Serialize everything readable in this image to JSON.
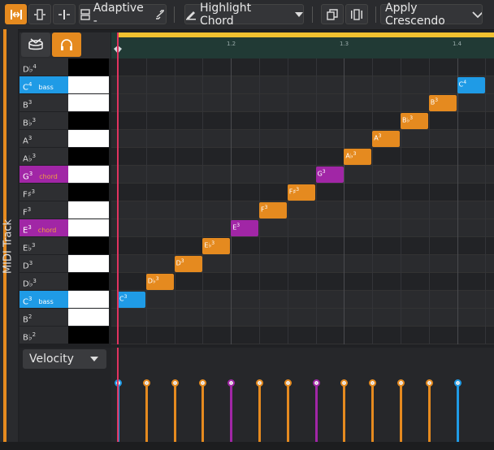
{
  "toolbar": {
    "snap_label": "Adaptive -",
    "highlight_label": "Highlight Chord",
    "crescendo_label": "Apply Crescendo"
  },
  "track": {
    "name": "MIDI Track",
    "color": "#e58a1f"
  },
  "timeline": {
    "markers": [
      "1.2",
      "1.3",
      "1.4"
    ]
  },
  "keys": [
    {
      "name": "D♭",
      "octave": "4",
      "tag": "",
      "black": true,
      "highlight": ""
    },
    {
      "name": "C",
      "octave": "4",
      "tag": "bass",
      "black": false,
      "highlight": "#1f9be6"
    },
    {
      "name": "B",
      "octave": "3",
      "tag": "",
      "black": false,
      "highlight": ""
    },
    {
      "name": "B♭",
      "octave": "3",
      "tag": "",
      "black": true,
      "highlight": ""
    },
    {
      "name": "A",
      "octave": "3",
      "tag": "",
      "black": false,
      "highlight": ""
    },
    {
      "name": "A♭",
      "octave": "3",
      "tag": "",
      "black": true,
      "highlight": ""
    },
    {
      "name": "G",
      "octave": "3",
      "tag": "chord",
      "black": false,
      "highlight": "#a126a6"
    },
    {
      "name": "F♯",
      "octave": "3",
      "tag": "",
      "black": true,
      "highlight": ""
    },
    {
      "name": "F",
      "octave": "3",
      "tag": "",
      "black": false,
      "highlight": ""
    },
    {
      "name": "E",
      "octave": "3",
      "tag": "chord",
      "black": false,
      "highlight": "#a126a6"
    },
    {
      "name": "E♭",
      "octave": "3",
      "tag": "",
      "black": true,
      "highlight": ""
    },
    {
      "name": "D",
      "octave": "3",
      "tag": "",
      "black": false,
      "highlight": ""
    },
    {
      "name": "D♭",
      "octave": "3",
      "tag": "",
      "black": true,
      "highlight": ""
    },
    {
      "name": "C",
      "octave": "3",
      "tag": "bass",
      "black": false,
      "highlight": "#1f9be6"
    },
    {
      "name": "B",
      "octave": "2",
      "tag": "",
      "black": false,
      "highlight": ""
    },
    {
      "name": "B♭",
      "octave": "2",
      "tag": "",
      "black": true,
      "highlight": ""
    }
  ],
  "notes": [
    {
      "name": "C",
      "octave": "3",
      "step": 0,
      "color": "#1f9be6"
    },
    {
      "name": "D♭",
      "octave": "3",
      "step": 1,
      "color": "#e58a1f"
    },
    {
      "name": "D",
      "octave": "3",
      "step": 2,
      "color": "#e58a1f"
    },
    {
      "name": "E♭",
      "octave": "3",
      "step": 3,
      "color": "#e58a1f"
    },
    {
      "name": "E",
      "octave": "3",
      "step": 4,
      "color": "#a126a6"
    },
    {
      "name": "F",
      "octave": "3",
      "step": 5,
      "color": "#e58a1f"
    },
    {
      "name": "F♯",
      "octave": "3",
      "step": 6,
      "color": "#e58a1f"
    },
    {
      "name": "G",
      "octave": "3",
      "step": 7,
      "color": "#a126a6"
    },
    {
      "name": "A♭",
      "octave": "3",
      "step": 8,
      "color": "#e58a1f"
    },
    {
      "name": "A",
      "octave": "3",
      "step": 9,
      "color": "#e58a1f"
    },
    {
      "name": "B♭",
      "octave": "3",
      "step": 10,
      "color": "#e58a1f"
    },
    {
      "name": "B",
      "octave": "3",
      "step": 11,
      "color": "#e58a1f"
    },
    {
      "name": "C",
      "octave": "4",
      "step": 12,
      "color": "#1f9be6"
    }
  ],
  "velocity": {
    "label": "Velocity"
  }
}
